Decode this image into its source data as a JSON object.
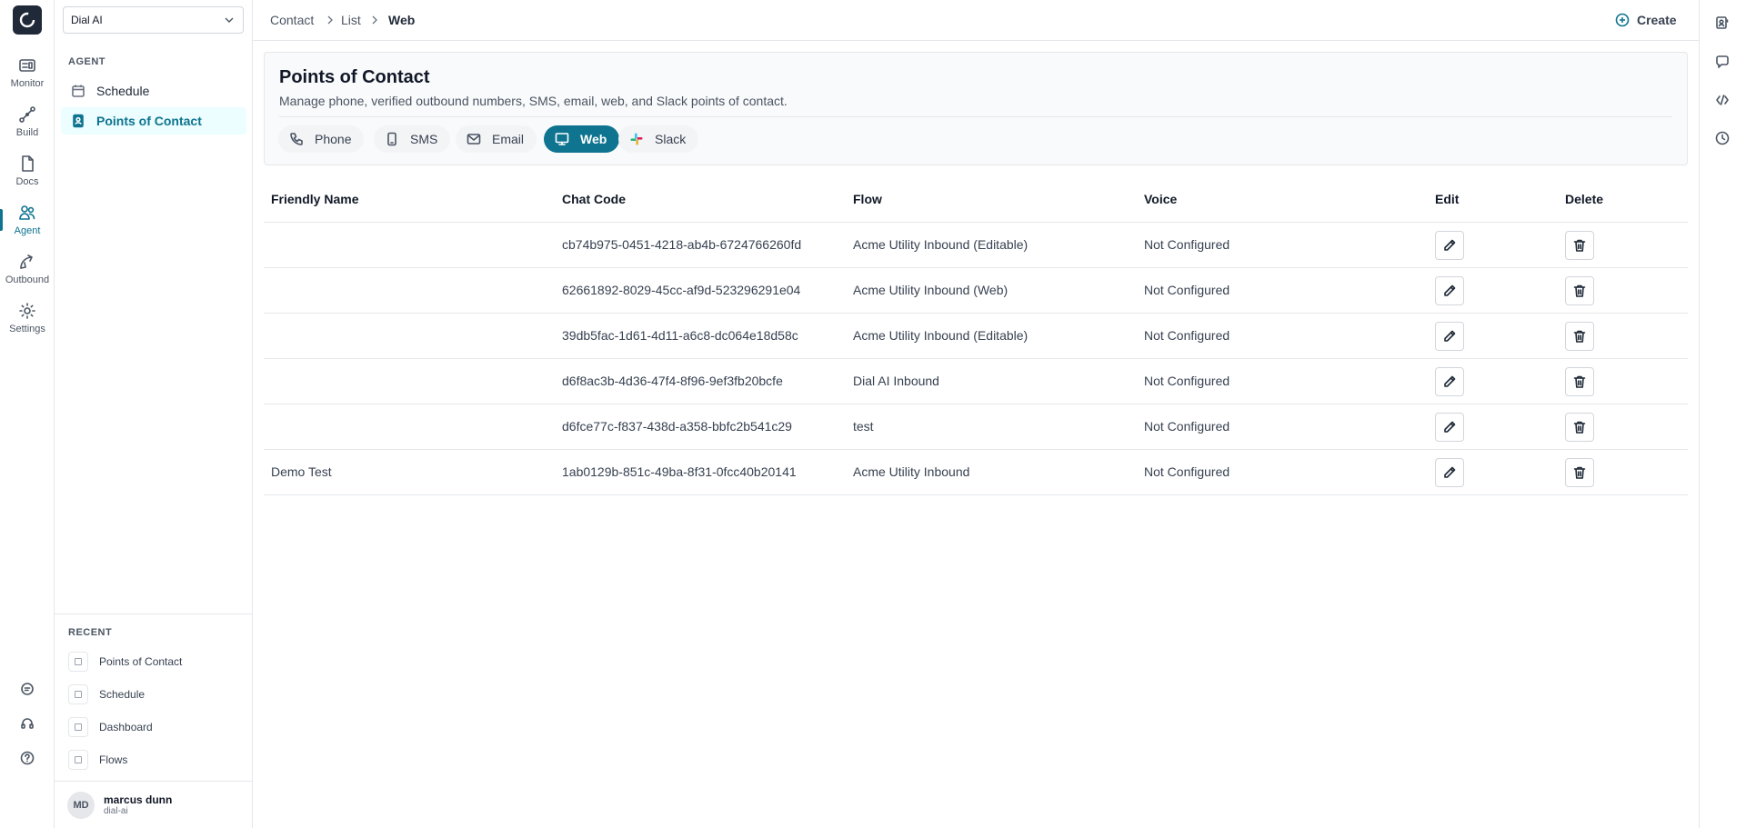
{
  "org_selector": {
    "value": "Dial AI"
  },
  "rail": {
    "items": [
      {
        "label": "Monitor",
        "icon": "monitor-icon"
      },
      {
        "label": "Build",
        "icon": "build-icon"
      },
      {
        "label": "Docs",
        "icon": "docs-icon"
      },
      {
        "label": "Agent",
        "icon": "agent-icon",
        "active": true
      },
      {
        "label": "Outbound",
        "icon": "outbound-icon"
      },
      {
        "label": "Settings",
        "icon": "gear-icon"
      }
    ],
    "bottom": [
      "chat-icon",
      "headset-icon",
      "help-icon"
    ]
  },
  "sidebar": {
    "section_label": "AGENT",
    "items": [
      {
        "label": "Schedule",
        "icon": "calendar-icon"
      },
      {
        "label": "Points of Contact",
        "icon": "contact-book-icon",
        "active": true
      }
    ],
    "recent_label": "RECENT",
    "recent": [
      {
        "label": "Points of Contact"
      },
      {
        "label": "Schedule"
      },
      {
        "label": "Dashboard"
      },
      {
        "label": "Flows"
      }
    ]
  },
  "user": {
    "initials": "MD",
    "name": "marcus dunn",
    "org": "dial-ai"
  },
  "breadcrumb": {
    "items": [
      "Contact",
      "List",
      "Web"
    ]
  },
  "header": {
    "create_label": "Create"
  },
  "right_rail": [
    "contacts-icon",
    "chat-bubble-icon",
    "code-icon",
    "history-icon"
  ],
  "page": {
    "title": "Points of Contact",
    "description": "Manage phone, verified outbound numbers, SMS, email, web, and Slack points of contact."
  },
  "tabs": [
    {
      "label": "Phone",
      "icon": "phone-icon"
    },
    {
      "label": "SMS",
      "icon": "mobile-icon"
    },
    {
      "label": "Email",
      "icon": "mail-icon"
    },
    {
      "label": "Web",
      "icon": "web-icon",
      "active": true
    },
    {
      "label": "Slack",
      "icon": "slack-icon"
    }
  ],
  "table": {
    "columns": [
      "Friendly Name",
      "Chat Code",
      "Flow",
      "Voice",
      "Edit",
      "Delete"
    ],
    "rows": [
      {
        "name": "",
        "code": "cb74b975-0451-4218-ab4b-6724766260fd",
        "flow": "Acme Utility Inbound (Editable)",
        "voice": "Not Configured"
      },
      {
        "name": "",
        "code": "62661892-8029-45cc-af9d-523296291e04",
        "flow": "Acme Utility Inbound (Web)",
        "voice": "Not Configured"
      },
      {
        "name": "",
        "code": "39db5fac-1d61-4d11-a6c8-dc064e18d58c",
        "flow": "Acme Utility Inbound (Editable)",
        "voice": "Not Configured"
      },
      {
        "name": "",
        "code": "d6f8ac3b-4d36-47f4-8f96-9ef3fb20bcfe",
        "flow": "Dial AI Inbound",
        "voice": "Not Configured"
      },
      {
        "name": "",
        "code": "d6fce77c-f837-438d-a358-bbfc2b541c29",
        "flow": "test",
        "voice": "Not Configured"
      },
      {
        "name": "Demo Test",
        "code": "1ab0129b-851c-49ba-8f31-0fcc40b20141",
        "flow": "Acme Utility Inbound",
        "voice": "Not Configured"
      }
    ]
  },
  "colors": {
    "accent": "#0e7490",
    "active_bg": "#ecfeff",
    "border": "#e5e7eb"
  }
}
